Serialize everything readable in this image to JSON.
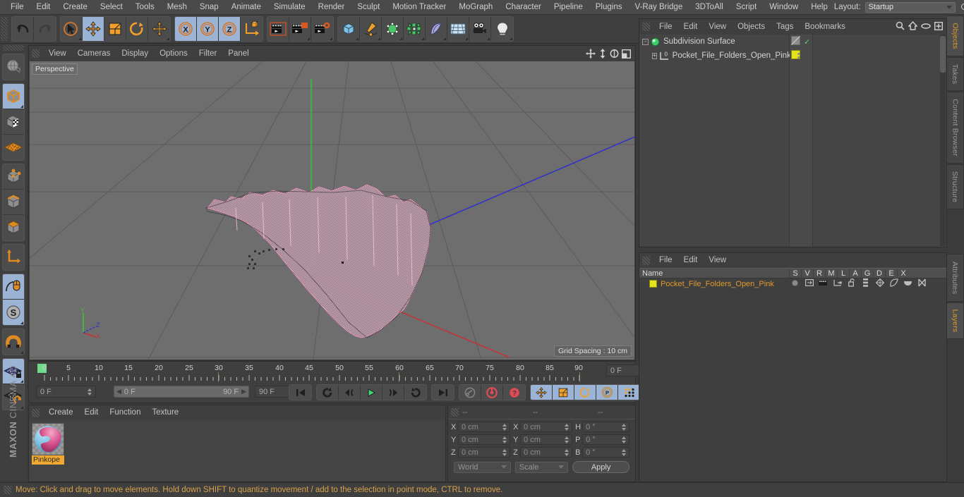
{
  "app": {
    "title": "CINEMA 4D",
    "brand_prefix": "MAXON"
  },
  "menubar": {
    "items": [
      "File",
      "Edit",
      "Create",
      "Select",
      "Tools",
      "Mesh",
      "Snap",
      "Animate",
      "Simulate",
      "Render",
      "Sculpt",
      "Motion Tracker",
      "MoGraph",
      "Character",
      "Pipeline",
      "Plugins",
      "V-Ray Bridge",
      "3DToAll",
      "Script",
      "Window",
      "Help"
    ],
    "layout_label": "Layout:",
    "layout_value": "Startup",
    "search_icon": "search-icon"
  },
  "toolbar": {
    "groups": [
      {
        "name": "history",
        "buttons": [
          {
            "name": "undo-button",
            "icon": "undo-icon",
            "selected": false,
            "corner": false
          },
          {
            "name": "redo-button",
            "icon": "redo-icon",
            "selected": false,
            "corner": false
          }
        ]
      },
      {
        "name": "tools",
        "buttons": [
          {
            "name": "live-selection-tool",
            "icon": "cursor-circle-icon",
            "selected": false,
            "corner": true
          },
          {
            "name": "move-tool",
            "icon": "move-icon",
            "selected": true,
            "corner": false
          },
          {
            "name": "scale-tool",
            "icon": "scale-icon",
            "selected": false,
            "corner": false
          },
          {
            "name": "rotate-tool",
            "icon": "rotate-icon",
            "selected": false,
            "corner": false
          },
          {
            "name": "move-extra-tool",
            "icon": "move-icon",
            "selected": false,
            "corner": true
          }
        ]
      },
      {
        "name": "axis-locks",
        "buttons": [
          {
            "name": "lock-x-button",
            "icon": "x-axis-icon",
            "selected": true,
            "corner": false
          },
          {
            "name": "lock-y-button",
            "icon": "y-axis-icon",
            "selected": true,
            "corner": false
          },
          {
            "name": "lock-z-button",
            "icon": "z-axis-icon",
            "selected": true,
            "corner": false
          },
          {
            "name": "world-object-coord-button",
            "icon": "world-axis-icon",
            "selected": false,
            "corner": false
          }
        ]
      },
      {
        "name": "render",
        "buttons": [
          {
            "name": "render-view-button",
            "icon": "render-view-icon",
            "selected": false,
            "corner": false
          },
          {
            "name": "render-region-button",
            "icon": "render-region-icon",
            "selected": false,
            "corner": true
          },
          {
            "name": "render-settings-button",
            "icon": "render-settings-icon",
            "selected": false,
            "corner": true
          }
        ]
      },
      {
        "name": "creation",
        "buttons": [
          {
            "name": "add-cube-button",
            "icon": "cube-icon",
            "selected": false,
            "corner": true
          },
          {
            "name": "add-spline-button",
            "icon": "pen-spline-icon",
            "selected": false,
            "corner": true
          },
          {
            "name": "add-generator-button",
            "icon": "green-cube-icon",
            "selected": false,
            "corner": true
          },
          {
            "name": "add-deformer-button",
            "icon": "deformer-icon",
            "selected": false,
            "corner": true
          },
          {
            "name": "add-scene-button",
            "icon": "bend-surface-icon",
            "selected": false,
            "corner": true
          },
          {
            "name": "add-environment-button",
            "icon": "floor-grid-icon",
            "selected": false,
            "corner": true
          },
          {
            "name": "add-camera-button",
            "icon": "camera-icon",
            "selected": false,
            "corner": true
          },
          {
            "name": "add-light-button",
            "icon": "light-bulb-icon",
            "selected": false,
            "corner": true
          }
        ]
      }
    ]
  },
  "left_palette": {
    "groups": [
      {
        "name": "global-axis",
        "buttons": [
          {
            "name": "make-editable-button",
            "icon": "globe-mesh-icon",
            "selected": false
          }
        ]
      },
      {
        "name": "modes",
        "buttons": [
          {
            "name": "model-mode-button",
            "icon": "model-cube-icon",
            "selected": true,
            "corner": true
          },
          {
            "name": "texture-mode-button",
            "icon": "texture-cube-icon",
            "selected": false
          },
          {
            "name": "uv-mode-button",
            "icon": "uv-mesh-icon",
            "selected": false
          }
        ]
      },
      {
        "name": "components",
        "buttons": [
          {
            "name": "points-mode-button",
            "icon": "points-cube-icon",
            "selected": false
          },
          {
            "name": "edges-mode-button",
            "icon": "edges-cube-icon",
            "selected": false
          },
          {
            "name": "polygons-mode-button",
            "icon": "polygons-cube-icon",
            "selected": false
          }
        ]
      },
      {
        "name": "axis-tools",
        "buttons": [
          {
            "name": "enable-axis-button",
            "icon": "axis-arrow-icon",
            "selected": false
          }
        ]
      },
      {
        "name": "snap-tools",
        "buttons": [
          {
            "name": "workplane-button",
            "icon": "mouse-curve-icon",
            "selected": true
          },
          {
            "name": "soft-selection-button",
            "icon": "s-circle-icon",
            "selected": true,
            "corner": true
          }
        ]
      },
      {
        "name": "magnet",
        "buttons": [
          {
            "name": "magnet-button",
            "icon": "magnet-icon",
            "selected": false,
            "corner": true
          }
        ]
      },
      {
        "name": "workplane",
        "buttons": [
          {
            "name": "lock-workplane-button",
            "icon": "grid-lock-icon",
            "selected": true,
            "corner": true
          },
          {
            "name": "planar-workplane-button",
            "icon": "grid-rotate-icon",
            "selected": false,
            "corner": true
          }
        ]
      }
    ]
  },
  "viewport": {
    "menu": [
      "View",
      "Cameras",
      "Display",
      "Options",
      "Filter",
      "Panel"
    ],
    "nav_icons": [
      "pan-icon",
      "dolly-icon",
      "rotate-icon",
      "maximize-icon"
    ],
    "label": "Perspective",
    "grid_spacing": "Grid Spacing : 10 cm",
    "axis_labels": {
      "x": "X",
      "y": "Y",
      "z": "Z"
    }
  },
  "timeline": {
    "ticks": [
      "0",
      "5",
      "10",
      "15",
      "20",
      "25",
      "30",
      "35",
      "40",
      "45",
      "50",
      "55",
      "60",
      "65",
      "70",
      "75",
      "80",
      "85",
      "90"
    ],
    "current_frame_field": "0 F",
    "scrub_start": "0 F",
    "scrub_end": "90 F",
    "end_frame_field": "90 F",
    "preview_frame_field": "0 F",
    "transport": [
      {
        "name": "go-to-start-button",
        "icon": "skip-start-icon"
      },
      {
        "name": "play-backwards-loop-button",
        "icon": "loop-back-icon"
      },
      {
        "name": "previous-frame-button",
        "icon": "step-back-icon"
      },
      {
        "name": "play-button",
        "icon": "play-icon",
        "active": true
      },
      {
        "name": "next-frame-button",
        "icon": "step-forward-icon"
      },
      {
        "name": "play-forwards-loop-button",
        "icon": "loop-forward-icon"
      },
      {
        "name": "go-to-end-button",
        "icon": "skip-end-icon"
      }
    ],
    "record_group": [
      {
        "name": "autokeying-button",
        "icon": "key-icon"
      },
      {
        "name": "record-button",
        "icon": "record-red-icon"
      },
      {
        "name": "keyframe-selection-button",
        "icon": "question-red-icon"
      }
    ],
    "key_group": [
      {
        "name": "position-key-button",
        "icon": "move-icon",
        "selected": true
      },
      {
        "name": "scale-key-button",
        "icon": "scale-icon",
        "selected": true
      },
      {
        "name": "rotation-key-button",
        "icon": "rotate-icon",
        "selected": true
      },
      {
        "name": "param-key-button",
        "icon": "p-circle-icon",
        "selected": true
      },
      {
        "name": "pla-key-button",
        "icon": "point-grid-icon",
        "selected": true
      }
    ],
    "timeline_button": {
      "name": "open-timeline-button",
      "icon": "filmstrip-icon",
      "selected": true
    }
  },
  "material_manager": {
    "menu": [
      "Create",
      "Edit",
      "Function",
      "Texture"
    ],
    "materials": [
      {
        "name": "Pinkope",
        "preview": "pink-blue-sphere"
      }
    ]
  },
  "coordinates": {
    "header_dashes": [
      "--",
      "--",
      "--"
    ],
    "rows": [
      {
        "label1": "X",
        "value1": "0 cm",
        "label2": "X",
        "value2": "0 cm",
        "label3": "H",
        "value3": "0 °"
      },
      {
        "label1": "Y",
        "value1": "0 cm",
        "label2": "Y",
        "value2": "0 cm",
        "label3": "P",
        "value3": "0 °"
      },
      {
        "label1": "Z",
        "value1": "0 cm",
        "label2": "Z",
        "value2": "0 cm",
        "label3": "B",
        "value3": "0 °"
      }
    ],
    "system_select": "World",
    "mode_select": "Scale",
    "apply_label": "Apply"
  },
  "object_manager": {
    "menu": [
      "File",
      "Edit",
      "View",
      "Objects",
      "Tags",
      "Bookmarks"
    ],
    "header_icons": [
      "search-icon",
      "home-icon",
      "ellipse-icon",
      "plus-box-icon"
    ],
    "objects": [
      {
        "name": "Subdivision Surface",
        "icon": "subdivision-surface-icon",
        "indent": 0,
        "expander": "-",
        "tag_swatch": "diagonal",
        "check": "✓"
      },
      {
        "name": "Pocket_File_Folders_Open_Pink",
        "icon": "polygon-object-icon",
        "indent": 1,
        "expander": "+",
        "tag_swatch": "#e3e317",
        "check": ""
      }
    ]
  },
  "layer_manager": {
    "menu": [
      "File",
      "Edit",
      "View"
    ],
    "columns": [
      "Name",
      "S",
      "V",
      "R",
      "M",
      "L",
      "A",
      "G",
      "D",
      "E",
      "X"
    ],
    "rows": [
      {
        "name": "Pocket_File_Folders_Open_Pink",
        "color": "#e3e317",
        "icons": [
          "solo-dot-icon",
          "visible-icon",
          "render-icon",
          "manager-icon",
          "lock-open-icon",
          "animation-icon",
          "generators-icon",
          "deformers-icon",
          "expressions-icon",
          "xref-icon"
        ]
      }
    ]
  },
  "right_tabs": {
    "top": [
      {
        "label": "Objects",
        "active": true
      },
      {
        "label": "Takes",
        "active": false
      },
      {
        "label": "Content Browser",
        "active": false
      },
      {
        "label": "Structure",
        "active": false
      }
    ],
    "bottom": [
      {
        "label": "Attributes",
        "active": false
      },
      {
        "label": "Layers",
        "active": true
      }
    ]
  },
  "statusbar": {
    "message": "Move: Click and drag to move elements. Hold down SHIFT to quantize movement / add to the selection in point mode, CTRL to remove."
  },
  "colors": {
    "accent_orange": "#e09a2c",
    "selection_blue": "#9bb3d4",
    "panel_bg": "#3f3f3f",
    "viewport_bg": "#6e6e6e",
    "mesh_pink": "#f0a8c8",
    "axis_x": "#d03030",
    "axis_y": "#40c040",
    "axis_z": "#3838c8"
  }
}
